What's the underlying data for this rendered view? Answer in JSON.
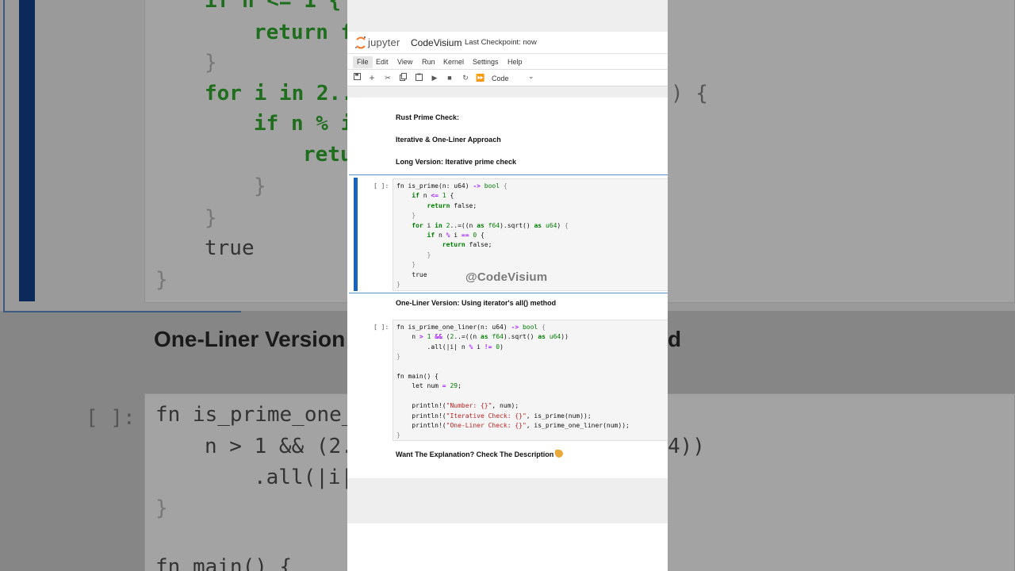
{
  "background": {
    "code_lines": [
      "if n <= 1 {",
      "return f",
      "}",
      "for i in 2..",
      "if n % i",
      "retu",
      "}",
      "}",
      "true",
      "}"
    ],
    "heading": "One-Liner Version",
    "heading_tail": "d",
    "prompt": "[ ]:",
    "code2": [
      "fn is_prime_one_",
      "n > 1 && (2.",
      "4))",
      ".all(|i|",
      "}",
      "fn main() {"
    ]
  },
  "header": {
    "brand": "jupyter",
    "notebook_title": "CodeVisium",
    "checkpoint": "Last Checkpoint: now"
  },
  "menu": [
    "File",
    "Edit",
    "View",
    "Run",
    "Kernel",
    "Settings",
    "Help"
  ],
  "toolbar": {
    "cell_type": "Code",
    "icons": [
      "save-icon",
      "add-icon",
      "cut-icon",
      "copy-icon",
      "paste-icon",
      "run-icon",
      "stop-icon",
      "restart-icon",
      "fast-forward-icon"
    ]
  },
  "markdown": {
    "title": "Rust Prime Check:",
    "subtitle": "Iterative & One-Liner Approach",
    "long_heading": "Long Version: Iterative prime check",
    "oneliner_heading": "One-Liner Version: Using iterator's all() method",
    "footer": "Want The Explanation? Check The Description"
  },
  "cells": [
    {
      "prompt": "[ ]:",
      "lines": [
        "fn is_prime(n: u64) -> bool {",
        "    if n <= 1 {",
        "        return false;",
        "    }",
        "    for i in 2..=((n as f64).sqrt() as u64) {",
        "        if n % i == 0 {",
        "            return false;",
        "        }",
        "    }",
        "    true",
        "}"
      ]
    },
    {
      "prompt": "[ ]:",
      "lines": [
        "fn is_prime_one_liner(n: u64) -> bool {",
        "    n > 1 && (2..=((n as f64).sqrt() as u64))",
        "        .all(|i| n % i != 0)",
        "}",
        "",
        "fn main() {",
        "    let num = 29;",
        "",
        "    println!(\"Number: {}\", num);",
        "    println!(\"Iterative Check: {}\", is_prime(num));",
        "    println!(\"One-Liner Check: {}\", is_prime_one_liner(num));",
        "}"
      ]
    }
  ],
  "watermark": "@CodeVisium",
  "colors": {
    "accent": "#1565c0",
    "keyword": "#008000",
    "operator": "#aa22ff",
    "string": "#ba2121"
  }
}
